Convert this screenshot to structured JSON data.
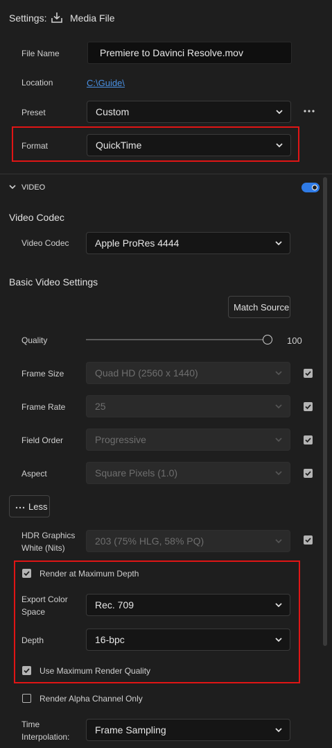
{
  "header": {
    "settings_label": "Settings:",
    "media_file_label": "Media File"
  },
  "file_name": {
    "label": "File Name",
    "value": "Premiere to Davinci Resolve.mov"
  },
  "location": {
    "label": "Location",
    "value": "C:\\Guide\\"
  },
  "preset": {
    "label": "Preset",
    "value": "Custom"
  },
  "format": {
    "label": "Format",
    "value": "QuickTime"
  },
  "video_section": {
    "title": "VIDEO",
    "enabled": true
  },
  "video_codec": {
    "heading": "Video Codec",
    "label": "Video Codec",
    "value": "Apple ProRes 4444"
  },
  "basic": {
    "heading": "Basic Video Settings",
    "match_source": "Match Source"
  },
  "quality": {
    "label": "Quality",
    "value": "100",
    "fraction": 1.0
  },
  "frame_size": {
    "label": "Frame Size",
    "value": "Quad HD (2560 x 1440)",
    "checked": true
  },
  "frame_rate": {
    "label": "Frame Rate",
    "value": "25",
    "checked": true
  },
  "field_order": {
    "label": "Field Order",
    "value": "Progressive",
    "checked": true
  },
  "aspect": {
    "label": "Aspect",
    "value": "Square Pixels (1.0)",
    "checked": true
  },
  "less_button": {
    "label": "Less"
  },
  "hdr": {
    "label_line1": "HDR Graphics",
    "label_line2": "White (Nits)",
    "value": "203 (75% HLG, 58% PQ)",
    "checked": true
  },
  "render_max_depth": {
    "label": "Render at Maximum Depth",
    "checked": true
  },
  "export_color_space": {
    "label_line1": "Export Color",
    "label_line2": "Space",
    "value": "Rec. 709"
  },
  "depth": {
    "label": "Depth",
    "value": "16-bpc"
  },
  "max_render_quality": {
    "label": "Use Maximum Render Quality",
    "checked": true
  },
  "alpha_only": {
    "label": "Render Alpha Channel Only",
    "checked": false
  },
  "time_interp": {
    "label_line1": "Time",
    "label_line2": "Interpolation:",
    "value": "Frame Sampling"
  },
  "colors": {
    "highlight": "#e01515",
    "toggle": "#2f7be6",
    "link": "#4a90e2"
  }
}
